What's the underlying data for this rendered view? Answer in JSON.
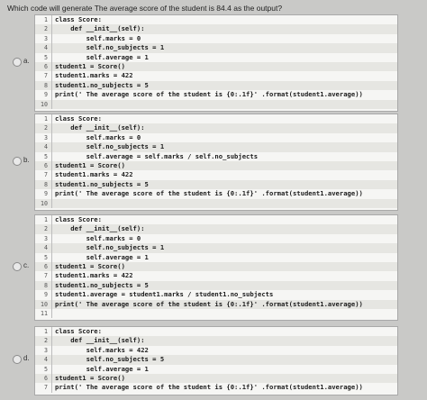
{
  "question": "Which code will generate The average score of the student is 84.4 as the output?",
  "options": [
    {
      "label": "a.",
      "lines": [
        "class Score:",
        "    def __init__(self):",
        "        self.marks = 0",
        "        self.no_subjects = 1",
        "        self.average = 1",
        "student1 = Score()",
        "student1.marks = 422",
        "student1.no_subjects = 5",
        "print(' The average score of the student is {0:.1f}' .format(student1.average))",
        ""
      ]
    },
    {
      "label": "b.",
      "lines": [
        "class Score:",
        "    def __init__(self):",
        "        self.marks = 0",
        "        self.no_subjects = 1",
        "        self.average = self.marks / self.no_subjects",
        "student1 = Score()",
        "student1.marks = 422",
        "student1.no_subjects = 5",
        "print(' The average score of the student is {0:.1f}' .format(student1.average))",
        ""
      ]
    },
    {
      "label": "c.",
      "lines": [
        "class Score:",
        "    def __init__(self):",
        "        self.marks = 0",
        "        self.no_subjects = 1",
        "        self.average = 1",
        "student1 = Score()",
        "student1.marks = 422",
        "student1.no_subjects = 5",
        "student1.average = student1.marks / student1.no_subjects",
        "print(' The average score of the student is {0:.1f}' .format(student1.average))",
        ""
      ]
    },
    {
      "label": "d.",
      "lines": [
        "class Score:",
        "    def __init__(self):",
        "        self.marks = 422",
        "        self.no_subjects = 5",
        "        self.average = 1",
        "student1 = Score()",
        "print(' The average score of the student is {0:.1f}' .format(student1.average))"
      ]
    }
  ]
}
